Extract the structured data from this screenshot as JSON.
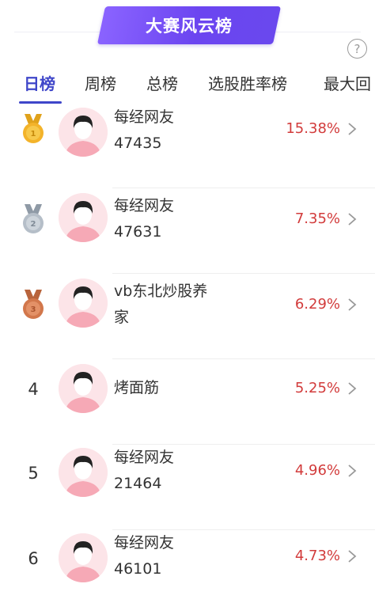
{
  "header": {
    "title": "大赛风云榜",
    "help_label": "?"
  },
  "tabs": [
    {
      "label": "日榜",
      "active": true
    },
    {
      "label": "周榜",
      "active": false
    },
    {
      "label": "总榜",
      "active": false
    },
    {
      "label": "选股胜率榜",
      "active": false
    },
    {
      "label": "最大回",
      "active": false
    }
  ],
  "rows": [
    {
      "rank": "1",
      "medal": "gold-medal-icon",
      "name_line1": "每经网友",
      "name_line2": "47435",
      "return_pct": "15.38%"
    },
    {
      "rank": "2",
      "medal": "silver-medal-icon",
      "name_line1": "每经网友",
      "name_line2": "47631",
      "return_pct": "7.35%"
    },
    {
      "rank": "3",
      "medal": "bronze-medal-icon",
      "name_line1": "vb东北炒股养",
      "name_line2": "家",
      "return_pct": "6.29%"
    },
    {
      "rank": "4",
      "medal": null,
      "name_line1": "烤面筋",
      "name_line2": "",
      "return_pct": "5.25%"
    },
    {
      "rank": "5",
      "medal": null,
      "name_line1": "每经网友",
      "name_line2": "21464",
      "return_pct": "4.96%"
    },
    {
      "rank": "6",
      "medal": null,
      "name_line1": "每经网友",
      "name_line2": "46101",
      "return_pct": "4.73%"
    }
  ],
  "colors": {
    "accent": "#3f46c9",
    "banner": "#7250f2",
    "return_red": "#d23b3b"
  }
}
